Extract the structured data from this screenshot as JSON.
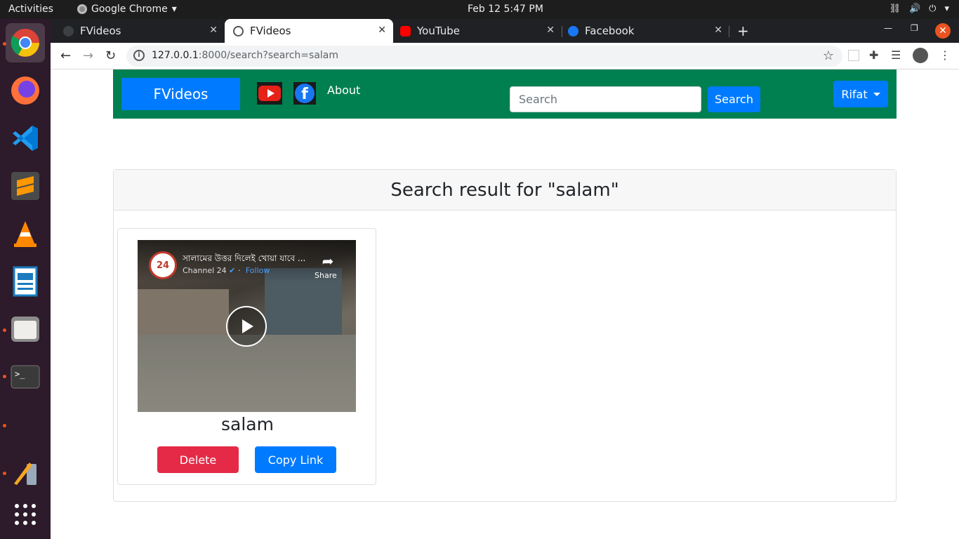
{
  "system": {
    "activities": "Activities",
    "app_name": "Google Chrome",
    "clock": "Feb 12  5:47 PM"
  },
  "tabs": [
    {
      "title": "FVideos",
      "active": false
    },
    {
      "title": "FVideos",
      "active": true
    },
    {
      "title": "YouTube",
      "active": false
    },
    {
      "title": "Facebook",
      "active": false
    }
  ],
  "address": {
    "host": "127.0.0.1",
    "rest": ":8000/search?search=salam"
  },
  "navbar": {
    "brand": "FVideos",
    "about": "About",
    "search_placeholder": "Search",
    "search_button": "Search",
    "user": "Rifat",
    "bg_color": "#008050",
    "accent_color": "#007bff"
  },
  "results": {
    "heading": "Search result for \"salam\"",
    "videos": [
      {
        "embed_title": "সালামের উত্তর দিলেই খোয়া যাবে ...",
        "embed_channel": "Channel 24",
        "embed_follow": "Follow",
        "embed_share": "Share",
        "channel_logo": "24",
        "name": "salam",
        "delete_label": "Delete",
        "copy_label": "Copy Link"
      }
    ]
  }
}
